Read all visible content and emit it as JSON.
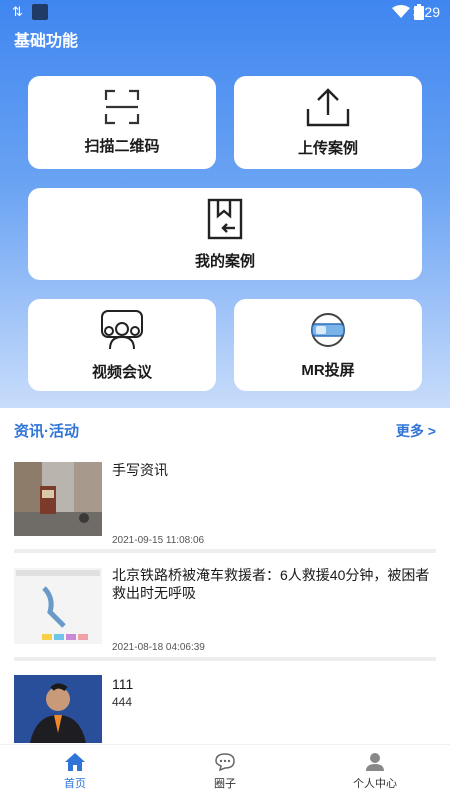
{
  "status_bar": {
    "time": "3:29"
  },
  "page_title": "基础功能",
  "grid": {
    "scan": "扫描二维码",
    "upload": "上传案例",
    "my_cases": "我的案例",
    "video_meeting": "视频会议",
    "mr_cast": "MR投屏"
  },
  "section": {
    "title": "资讯·活动",
    "more": "更多 >"
  },
  "news": [
    {
      "title": "手写资讯",
      "subtitle": "",
      "date": "2021-09-15 11:08:06"
    },
    {
      "title": "北京铁路桥被淹车救援者：6人救援40分钟，被困者救出时无呼吸",
      "subtitle": "",
      "date": "2021-08-18 04:06:39"
    },
    {
      "title": "111",
      "subtitle": "444",
      "date": ""
    }
  ],
  "bottom_nav": [
    {
      "label": "首页",
      "active": true
    },
    {
      "label": "圈子",
      "active": false
    },
    {
      "label": "个人中心",
      "active": false
    }
  ],
  "colors": {
    "accent": "#2f74d6",
    "hero_top": "#3f86f0",
    "hero_bottom": "#c8dcfb"
  }
}
